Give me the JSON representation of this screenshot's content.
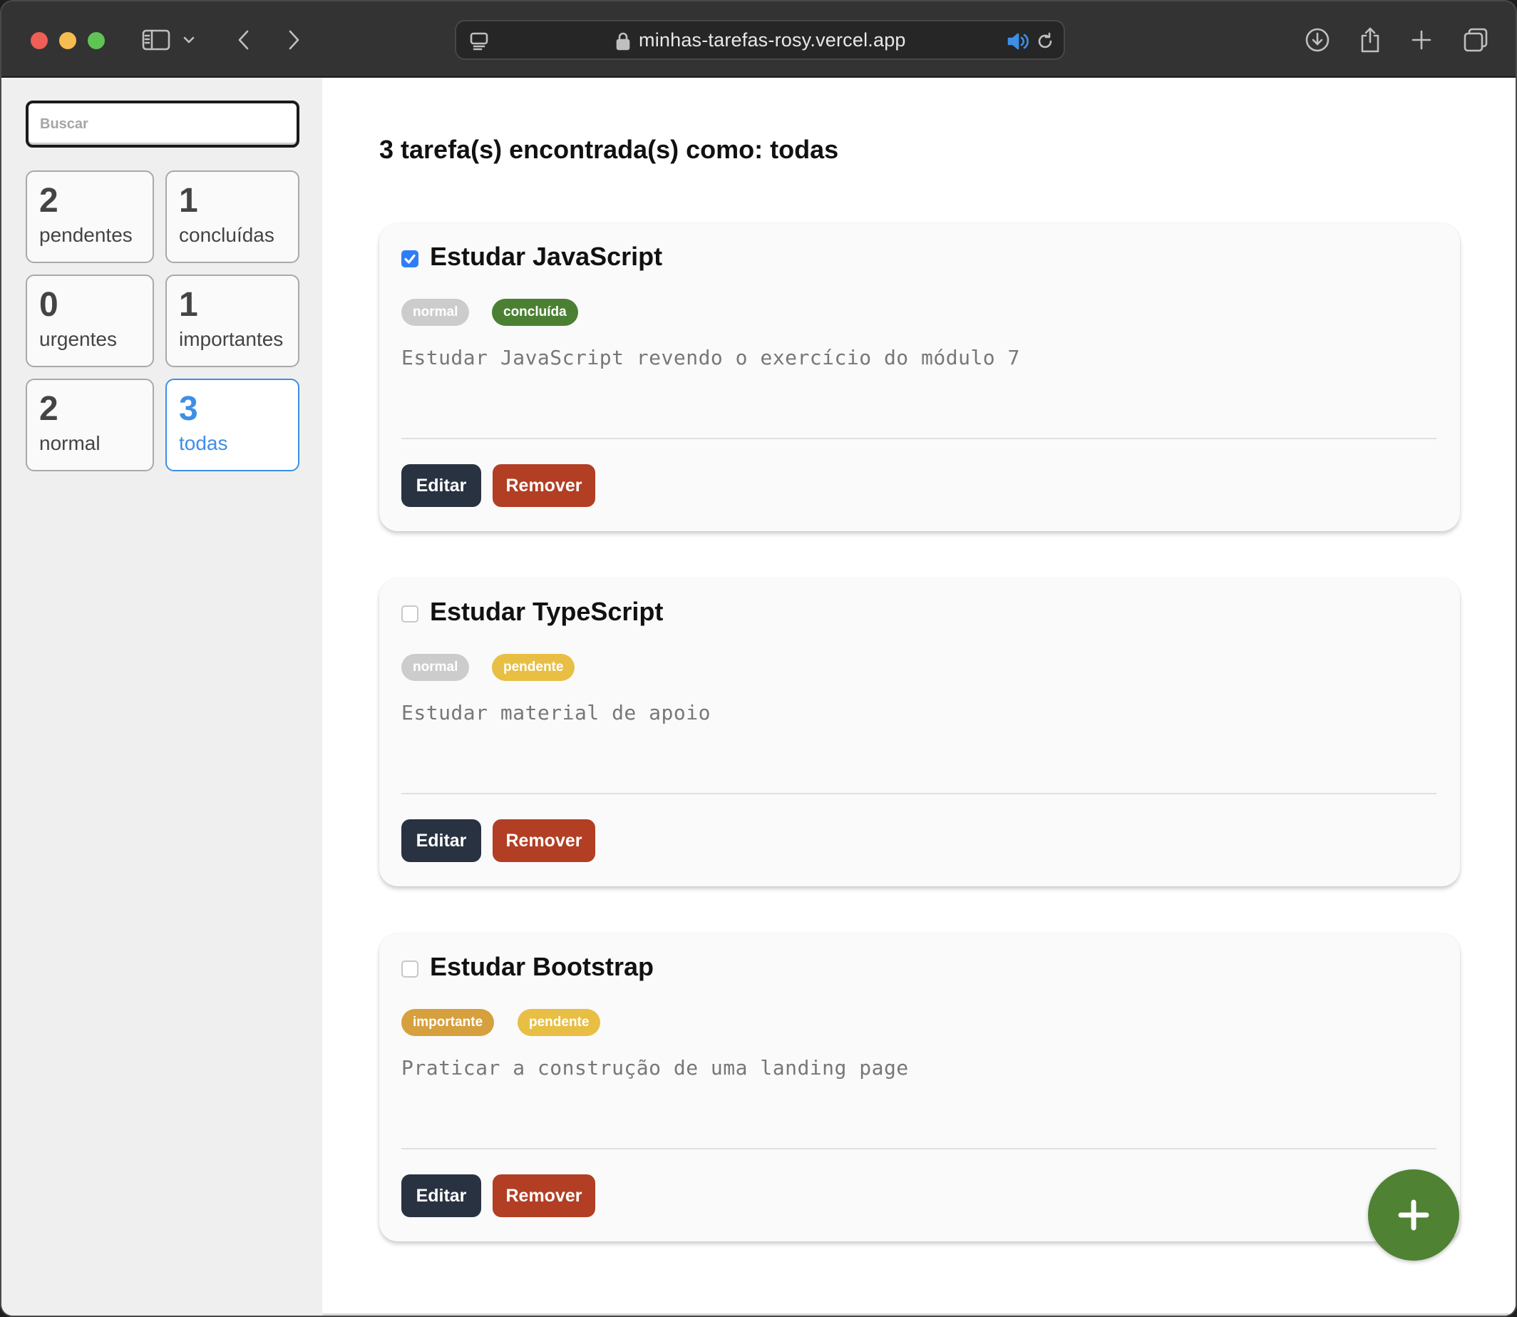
{
  "browser": {
    "url": "minhas-tarefas-rosy.vercel.app"
  },
  "sidebar": {
    "search_placeholder": "Buscar",
    "filters": [
      {
        "count": "2",
        "label": "pendentes"
      },
      {
        "count": "1",
        "label": "concluídas"
      },
      {
        "count": "0",
        "label": "urgentes"
      },
      {
        "count": "1",
        "label": "importantes"
      },
      {
        "count": "2",
        "label": "normal"
      },
      {
        "count": "3",
        "label": "todas"
      }
    ],
    "active_filter": "todas"
  },
  "main": {
    "heading": "3 tarefa(s) encontrada(s) como: todas",
    "tasks": [
      {
        "title": "Estudar JavaScript",
        "checked": true,
        "priority": "normal",
        "status": "concluída",
        "description": "Estudar JavaScript revendo o exercício do módulo 7",
        "edit_label": "Editar",
        "remove_label": "Remover"
      },
      {
        "title": "Estudar TypeScript",
        "checked": false,
        "priority": "normal",
        "status": "pendente",
        "description": "Estudar material de apoio",
        "edit_label": "Editar",
        "remove_label": "Remover"
      },
      {
        "title": "Estudar Bootstrap",
        "checked": false,
        "priority": "importante",
        "status": "pendente",
        "description": "Praticar a construção de uma landing page",
        "edit_label": "Editar",
        "remove_label": "Remover"
      }
    ]
  },
  "colors": {
    "badge_normal": "#cccccc",
    "badge_concluida": "#4b8033",
    "badge_pendente": "#e8bf44",
    "badge_importante": "#d6a03e",
    "active_filter": "#3d8fe6",
    "edit_button": "#293241",
    "remove_button": "#b23e24",
    "fab": "#4f8233"
  },
  "icons": {
    "fab": "plus-icon"
  }
}
